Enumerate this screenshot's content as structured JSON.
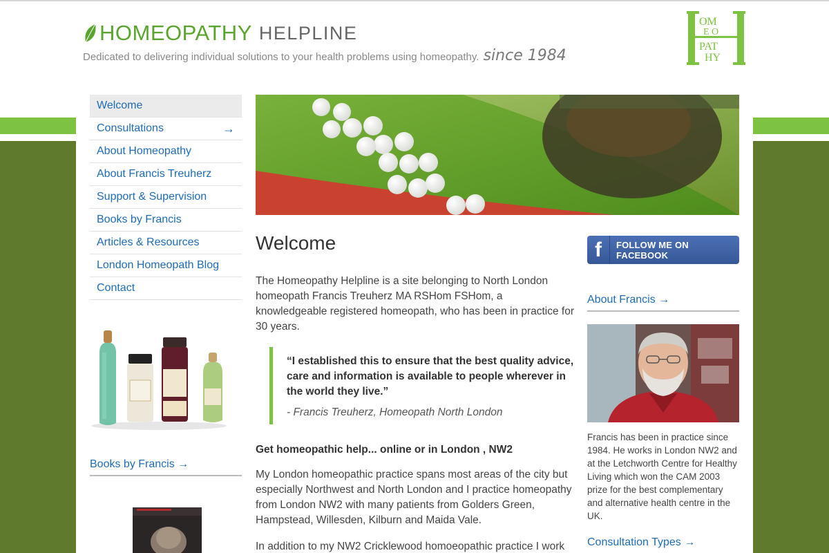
{
  "header": {
    "brand_main": "HOMEOPATHY",
    "brand_sub": "HELPLINE",
    "tagline": "Dedicated to delivering individual solutions to your health problems using homeopathy.",
    "since": "since 1984",
    "monogram": {
      "line1": "OM",
      "line2": "E O",
      "line3": "PAT",
      "line4": "HY",
      "big_letter": "H"
    }
  },
  "nav": {
    "items": [
      {
        "label": "Welcome",
        "active": true
      },
      {
        "label": "Consultations",
        "arrow": "→"
      },
      {
        "label": "About Homeopathy"
      },
      {
        "label": "About Francis Treuherz"
      },
      {
        "label": "Support & Supervision"
      },
      {
        "label": "Books by Francis"
      },
      {
        "label": "Articles & Resources"
      },
      {
        "label": "London Homeopath Blog"
      },
      {
        "label": "Contact"
      }
    ]
  },
  "sidebar": {
    "books_heading": "Books by Francis →"
  },
  "main": {
    "title": "Welcome",
    "intro": "The Homeopathy Helpline is a site belonging to North London homeopath Francis Treuherz MA RSHom FSHom, a knowledgeable registered homeopath, who has been in practice for 30 years.",
    "quote": "“I established this to ensure that the best quality advice, care and information is available to people wherever in the world they live.”",
    "quote_attr": "- Francis Treuherz, Homeopath North London",
    "sub_heading": "Get homeopathic help... online or in London , NW2",
    "para2": "My London homeopathic practice spans most areas of the city but especially Northwest and North London and I practice homeopathy from London NW2 with many patients from Golders Green, Hampstead, Willesden, Kilburn and Maida Vale.",
    "para3": "In addition to my NW2 Cricklewood homoeopathic practice I work"
  },
  "right": {
    "facebook_label": "FOLLOW ME ON FACEBOOK",
    "facebook_icon": "f",
    "about_heading": "About Francis →",
    "about_text": "Francis has been in practice since 1984. He works in London NW2 and at the Letchworth Centre for Healthy Living which won the CAM 2003 prize for the best complementary and alternative health centre in the UK.",
    "consult_heading": "Consultation Types →"
  },
  "colors": {
    "brand_green": "#5aa52d",
    "accent_green": "#7dc242",
    "olive": "#5f7a2c",
    "link_blue": "#1e6cb6",
    "facebook_blue": "#3b5998"
  }
}
